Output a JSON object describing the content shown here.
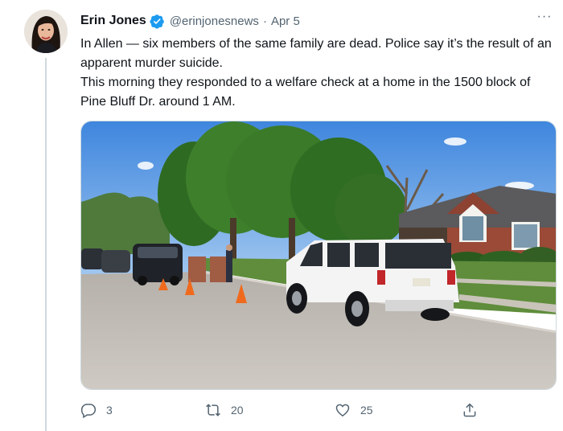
{
  "author": {
    "display_name": "Erin Jones",
    "handle": "@erinjonesnews",
    "separator": "·",
    "date": "Apr 5",
    "verified": true
  },
  "tweet": {
    "line1": "In Allen — six members of the same family are dead. Police say it’s the result of an apparent murder suicide.",
    "line2": "This morning they responded to a welfare check at a home in the 1500 block of Pine Bluff Dr. around 1 AM."
  },
  "more_label": "···",
  "actions": {
    "reply_count": "3",
    "retweet_count": "20",
    "like_count": "25"
  },
  "colors": {
    "text": "#0f1419",
    "secondary": "#536471",
    "verified": "#1d9bf0",
    "thread_line": "#cfd9de"
  },
  "icons": {
    "verified": "verified-badge-icon",
    "more": "more-options-icon",
    "reply": "reply-icon",
    "retweet": "retweet-icon",
    "like": "heart-icon",
    "share": "share-icon"
  }
}
